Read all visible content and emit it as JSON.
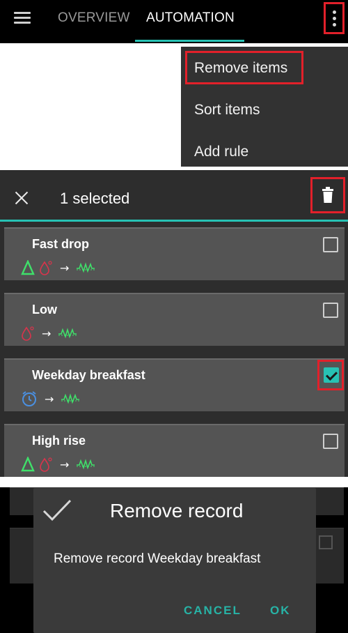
{
  "toolbar": {
    "tabs": [
      {
        "label": "OVERVIEW",
        "active": false
      },
      {
        "label": "AUTOMATION",
        "active": true
      }
    ],
    "menu_icon": "hamburger-icon",
    "overflow_icon": "more-vertical-icon"
  },
  "overflow_menu": {
    "items": [
      {
        "label": "Remove items",
        "highlighted": true
      },
      {
        "label": "Sort items"
      },
      {
        "label": "Add rule"
      }
    ]
  },
  "selection_bar": {
    "count_label": "1 selected",
    "close_icon": "close-icon",
    "delete_icon": "trash-icon"
  },
  "rules": [
    {
      "name": "Fast drop",
      "checked": false,
      "triggers": [
        "delta-icon",
        "drop-icon"
      ],
      "action": "profile-wave-icon"
    },
    {
      "name": "Low",
      "checked": false,
      "triggers": [
        "drop-icon"
      ],
      "action": "profile-wave-icon"
    },
    {
      "name": "Weekday breakfast",
      "checked": true,
      "triggers": [
        "alarm-clock-icon"
      ],
      "action": "profile-wave-icon"
    },
    {
      "name": "High rise",
      "checked": false,
      "triggers": [
        "delta-icon",
        "drop-icon"
      ],
      "action": "profile-wave-icon"
    }
  ],
  "dialog": {
    "title": "Remove record",
    "message": "Remove record Weekday breakfast",
    "cancel_label": "CANCEL",
    "ok_label": "OK"
  },
  "colors": {
    "accent": "#27c2b4",
    "highlight_box": "#e2202a",
    "menu_bg": "#323232",
    "card_bg": "#545454"
  }
}
